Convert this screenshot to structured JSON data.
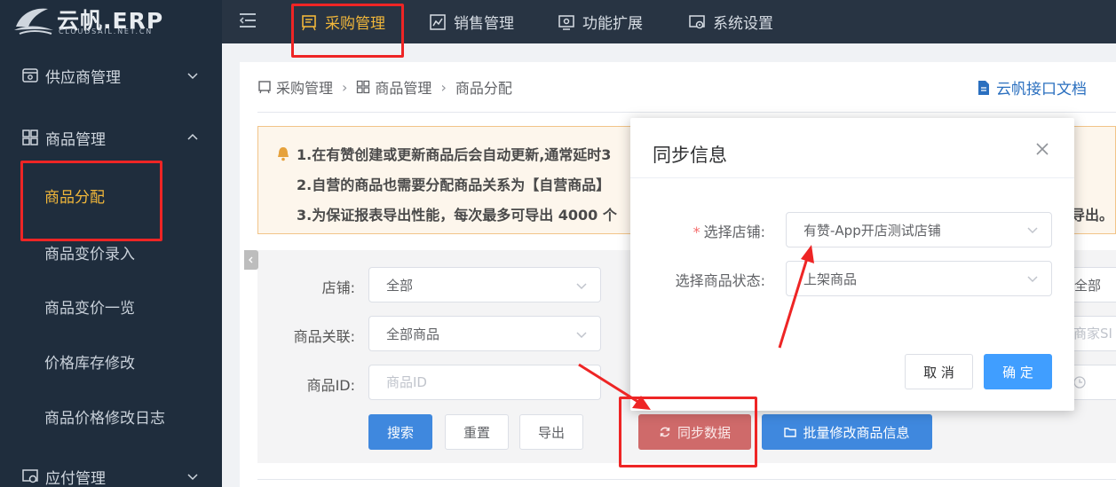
{
  "app": {
    "logo_text": "云帆.ERP",
    "logo_sub": "CLOUDSAIL.NET.CN"
  },
  "topnav": [
    {
      "label": "采购管理",
      "icon": "purchase-icon",
      "active": true
    },
    {
      "label": "销售管理",
      "icon": "chart-icon"
    },
    {
      "label": "功能扩展",
      "icon": "extension-icon"
    },
    {
      "label": "系统设置",
      "icon": "settings-icon"
    }
  ],
  "sidebar": {
    "groups": [
      {
        "label": "供应商管理",
        "icon": "supplier-icon",
        "expanded": false
      },
      {
        "label": "商品管理",
        "icon": "grid-icon",
        "expanded": true
      },
      {
        "label": "应付管理",
        "icon": "payable-icon",
        "expanded": false
      }
    ],
    "items": [
      {
        "label": "商品分配",
        "active": true
      },
      {
        "label": "商品变价录入"
      },
      {
        "label": "商品变价一览"
      },
      {
        "label": "价格库存修改"
      },
      {
        "label": "商品价格修改日志"
      }
    ]
  },
  "breadcrumb": {
    "root": "采购管理",
    "parent": "商品管理",
    "current": "商品分配"
  },
  "doc_link": "云帆接口文档",
  "notice": {
    "line1": "1.在有赞创建或更新商品后会自动更新,通常延时3",
    "line2": "2.自营的商品也需要分配商品关系为【自营商品】",
    "line3": "3.为保证报表导出性能，每次最多可导出 4000 个",
    "line3_tail": "导出。"
  },
  "filters": {
    "store_label": "店铺:",
    "store_value": "全部",
    "relation_label": "商品关联:",
    "relation_value": "全部商品",
    "id_label": "商品ID:",
    "id_placeholder": "商品ID",
    "right_select_value": "全部",
    "right_input_placeholder": "商家SI"
  },
  "buttons": {
    "search": "搜索",
    "reset": "重置",
    "export": "导出",
    "sync": "同步数据",
    "batch_edit": "批量修改商品信息"
  },
  "dialog": {
    "title": "同步信息",
    "store_label": "选择店铺:",
    "store_required": "*",
    "store_value": "有赞-App开店测试店铺",
    "status_label": "选择商品状态:",
    "status_value": "上架商品",
    "cancel": "取 消",
    "confirm": "确 定"
  },
  "colors": {
    "accent": "#f0b63a",
    "primary": "#3f88de",
    "annotation": "#ee2525"
  }
}
